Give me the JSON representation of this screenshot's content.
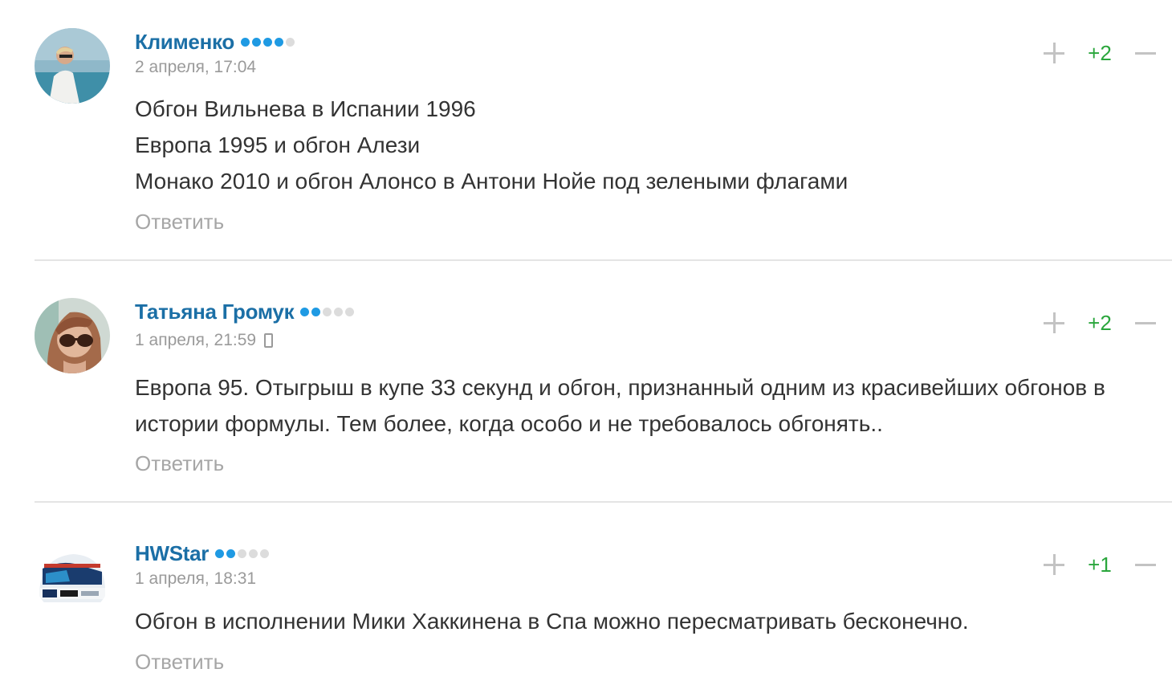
{
  "colors": {
    "author": "#1b6fa6",
    "rank_active": "#1f9ae3",
    "rank_inactive": "#dcdcdc",
    "score_positive": "#2aa63c",
    "meta": "#9a9a9a",
    "text": "#333333"
  },
  "comments": [
    {
      "author": "Клименко",
      "rank_level": 4,
      "rank_max": 5,
      "date": "2 апреля, 17:04",
      "mobile": false,
      "lines": [
        "Обгон Вильнева в Испании 1996",
        "Европа 1995 и обгон Алези",
        "Монако 2010 и обгон Алонсо в Антони Нойе под зелеными флагами"
      ],
      "score": "+2",
      "reply_label": "Ответить"
    },
    {
      "author": "Татьяна Громук",
      "rank_level": 2,
      "rank_max": 5,
      "date": "1 апреля, 21:59",
      "mobile": true,
      "mobile_icon": "phone-icon",
      "lines": [
        "Европа 95. Отыгрыш в купе 33 секунд и обгон, признанный одним из красивейших обгонов в истории формулы. Тем более, когда особо и не требовалось обгонять.."
      ],
      "score": "+2",
      "reply_label": "Ответить"
    },
    {
      "author": "HWStar",
      "rank_level": 2,
      "rank_max": 5,
      "date": "1 апреля, 18:31",
      "mobile": false,
      "lines": [
        "Обгон в исполнении Мики Хаккинена в Спа можно пересматривать бесконечно."
      ],
      "score": "+1",
      "reply_label": "Ответить"
    }
  ]
}
